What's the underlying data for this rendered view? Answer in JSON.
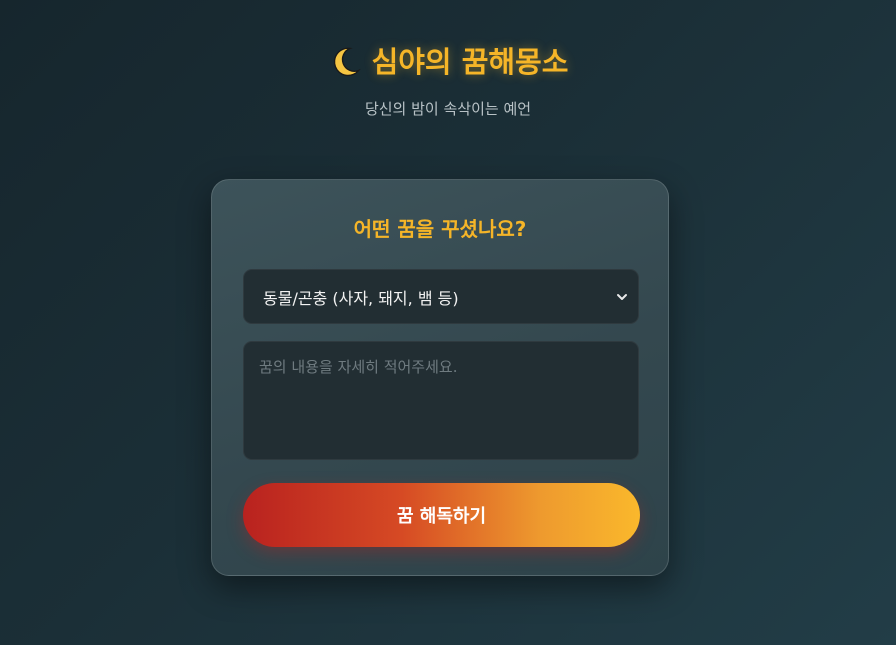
{
  "header": {
    "title": "심야의 꿈해몽소",
    "subtitle": "당신의 밤이 속삭이는 예언",
    "title_icon": "crescent-moon-icon",
    "accent_color": "#f5b528"
  },
  "form": {
    "heading": "어떤 꿈을 꾸셨나요?",
    "category_select": {
      "selected": "동물/곤충 (사자, 돼지, 뱀 등)",
      "icon": "chevron-down-icon"
    },
    "dream_textarea": {
      "placeholder": "꿈의 내용을 자세히 적어주세요.",
      "value": ""
    },
    "submit_label": "꿈 해독하기",
    "button_gradient": [
      "#b9221f",
      "#fab82c"
    ]
  }
}
